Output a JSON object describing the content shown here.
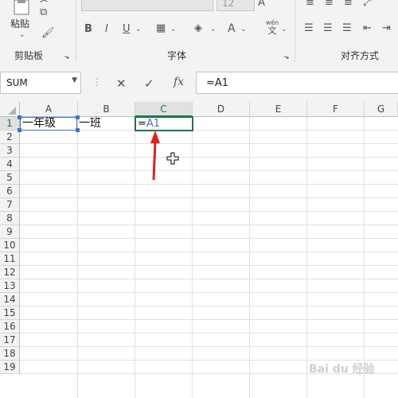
{
  "ribbon": {
    "clipboard": {
      "paste_label": "粘贴",
      "group_label": "剪贴板"
    },
    "font": {
      "size_value": "12",
      "group_label": "字体",
      "bold": "B",
      "italic": "I",
      "underline": "U",
      "phonetic_top": "wén",
      "phonetic_bottom": "文"
    },
    "alignment": {
      "group_label": "对齐方式"
    }
  },
  "formula_bar": {
    "name_box": "SUM",
    "cancel_symbol": "✕",
    "enter_symbol": "✓",
    "fx_label": "fx",
    "formula": "=A1"
  },
  "sheet": {
    "columns": [
      "A",
      "B",
      "C",
      "D",
      "E",
      "F",
      "G"
    ],
    "rows": [
      "1",
      "2",
      "3",
      "4",
      "5",
      "6",
      "7",
      "8",
      "9",
      "10",
      "11",
      "12",
      "13",
      "14",
      "15",
      "16",
      "17",
      "18",
      "19"
    ],
    "cells": {
      "A1": "一年级",
      "B1": "一班",
      "C1_eq": "=",
      "C1_ref": "A1"
    }
  },
  "colors": {
    "accent": "#217346",
    "reference": "#4472c4",
    "annotation_arrow": "#e02020"
  },
  "watermark": "Bai du 经验"
}
